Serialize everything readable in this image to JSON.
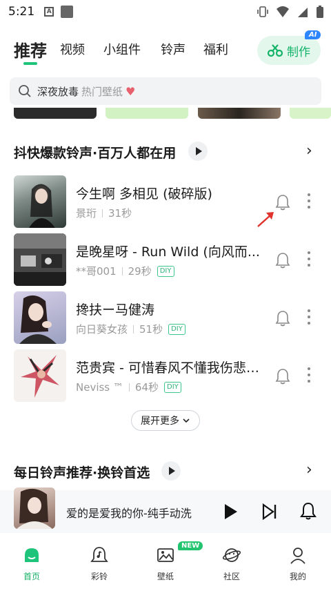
{
  "status_bar": {
    "time": "5:21"
  },
  "top_nav": {
    "tabs": [
      {
        "label": "推荐",
        "active": true
      },
      {
        "label": "视频"
      },
      {
        "label": "小组件"
      },
      {
        "label": "铃声"
      },
      {
        "label": "福利"
      }
    ],
    "make_button": {
      "label": "制作",
      "badge": "AI"
    }
  },
  "search": {
    "keyword": "深夜放毒",
    "hint": "热门壁纸",
    "heart_icon": "heart-icon"
  },
  "section1": {
    "title": "抖快爆款铃声·百万人都在用",
    "songs": [
      {
        "title": "今生啊 多相见 (破碎版)",
        "artist": "景珩",
        "duration": "31秒",
        "diy": ""
      },
      {
        "title": "是晚星呀 - Run Wild (向风而...",
        "artist": "**哥001",
        "duration": "29秒",
        "diy": "DIY"
      },
      {
        "title": "搀扶ー马健涛",
        "artist": "向日葵女孩",
        "duration": "51秒",
        "diy": "DIY"
      },
      {
        "title": "范贵宾 - 可惜春风不懂我伤悲-...",
        "artist": "Neviss ™",
        "duration": "64秒",
        "diy": "DIY"
      }
    ],
    "expand_label": "展开更多"
  },
  "section2": {
    "title": "每日铃声推荐·换铃首选"
  },
  "mini_player": {
    "title": "爱的是爱我的你-纯手动洗"
  },
  "bottom_nav": {
    "items": [
      {
        "label": "首页",
        "icon": "home-icon",
        "active": true
      },
      {
        "label": "彩铃",
        "icon": "ringtone-icon"
      },
      {
        "label": "壁纸",
        "icon": "wallpaper-icon",
        "badge": "NEW"
      },
      {
        "label": "社区",
        "icon": "community-icon"
      },
      {
        "label": "我的",
        "icon": "profile-icon"
      }
    ]
  },
  "colors": {
    "accent": "#1ec47a",
    "ai_badge": "#2e86ff",
    "diy_border": "#3cc88a"
  }
}
